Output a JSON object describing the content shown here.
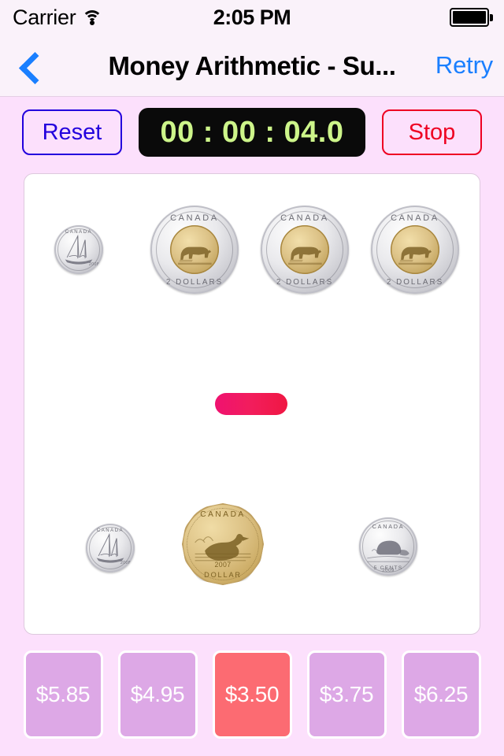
{
  "status_bar": {
    "carrier": "Carrier",
    "wifi_icon": "wifi-icon",
    "time": "2:05 PM",
    "battery_icon": "battery-full-icon"
  },
  "nav_bar": {
    "back_icon": "chevron-left-icon",
    "title": "Money Arithmetic - Su...",
    "retry_label": "Retry"
  },
  "controls": {
    "reset_label": "Reset",
    "stop_label": "Stop",
    "timer": "00 : 00 : 04.0",
    "timer_color": "#cdf58a",
    "reset_color": "#2200dd",
    "stop_color": "#ee0022"
  },
  "problem": {
    "operator": "minus",
    "operator_color": "#f01757",
    "top_row": [
      {
        "name": "dime",
        "value": "10 cents",
        "country": "CANADA",
        "denom": "10 CENTS",
        "year": "2008",
        "metal": "silver",
        "size": 62,
        "motif": "bluenose-schooner"
      },
      {
        "name": "toonie",
        "value": "2 dollars",
        "country": "CANADA",
        "denom": "2 DOLLARS",
        "year": "",
        "metal": "bimetal",
        "size": 112,
        "motif": "polar-bear"
      },
      {
        "name": "toonie",
        "value": "2 dollars",
        "country": "CANADA",
        "denom": "2 DOLLARS",
        "year": "",
        "metal": "bimetal",
        "size": 112,
        "motif": "polar-bear"
      },
      {
        "name": "toonie",
        "value": "2 dollars",
        "country": "CANADA",
        "denom": "2 DOLLARS",
        "year": "",
        "metal": "bimetal",
        "size": 112,
        "motif": "polar-bear"
      }
    ],
    "bottom_row": [
      {
        "name": "dime",
        "value": "10 cents",
        "country": "CANADA",
        "denom": "10 CENTS",
        "year": "2008",
        "metal": "silver",
        "size": 62,
        "motif": "bluenose-schooner"
      },
      {
        "name": "loonie",
        "value": "1 dollar",
        "country": "CANADA",
        "denom": "DOLLAR",
        "year": "2007",
        "metal": "gold",
        "size": 104,
        "motif": "loon"
      },
      {
        "name": "nickel",
        "value": "5 cents",
        "country": "CANADA",
        "denom": "5 CENTS",
        "year": "2009",
        "metal": "silver",
        "size": 74,
        "motif": "beaver"
      }
    ]
  },
  "answers": [
    {
      "label": "$5.85",
      "selected": false
    },
    {
      "label": "$4.95",
      "selected": false
    },
    {
      "label": "$3.50",
      "selected": true
    },
    {
      "label": "$3.75",
      "selected": false
    },
    {
      "label": "$6.25",
      "selected": false
    }
  ],
  "colors": {
    "page_background": "#fce0fc",
    "bar_background": "#faf2fa",
    "card_background": "#ffffff",
    "answer_background": "#dda8e6",
    "answer_selected": "#fc6b72",
    "accent_blue": "#1a7fff"
  }
}
